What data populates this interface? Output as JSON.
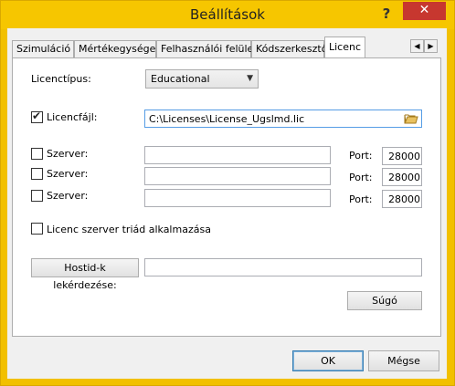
{
  "window": {
    "title": "Beállítások",
    "help_label": "?",
    "close_label": "✕"
  },
  "tabs": [
    {
      "label": "Szimuláció"
    },
    {
      "label": "Mértékegységek"
    },
    {
      "label": "Felhasználói felület"
    },
    {
      "label": "Kódszerkesztő"
    },
    {
      "label": "Licenc"
    }
  ],
  "tab_scroll": {
    "left": "◀",
    "right": "▶"
  },
  "license": {
    "type_label": "Licenctípus:",
    "type_value": "Educational",
    "file_checked": true,
    "file_label": "Licencfájl:",
    "file_value": "C:\\Licenses\\License_Ugslmd.lic",
    "servers": [
      {
        "label": "Szerver:",
        "value": "",
        "port_label": "Port:",
        "port_value": "28000",
        "checked": false
      },
      {
        "label": "Szerver:",
        "value": "",
        "port_label": "Port:",
        "port_value": "28000",
        "checked": false
      },
      {
        "label": "Szerver:",
        "value": "",
        "port_label": "Port:",
        "port_value": "28000",
        "checked": false
      }
    ],
    "triad_label": "Licenc szerver triád alkalmazása",
    "hostid_button": "Hostid-k lekérdezése:",
    "hostid_value": "",
    "help_button": "Súgó"
  },
  "footer": {
    "ok_label": "OK",
    "cancel_label": "Mégse"
  }
}
